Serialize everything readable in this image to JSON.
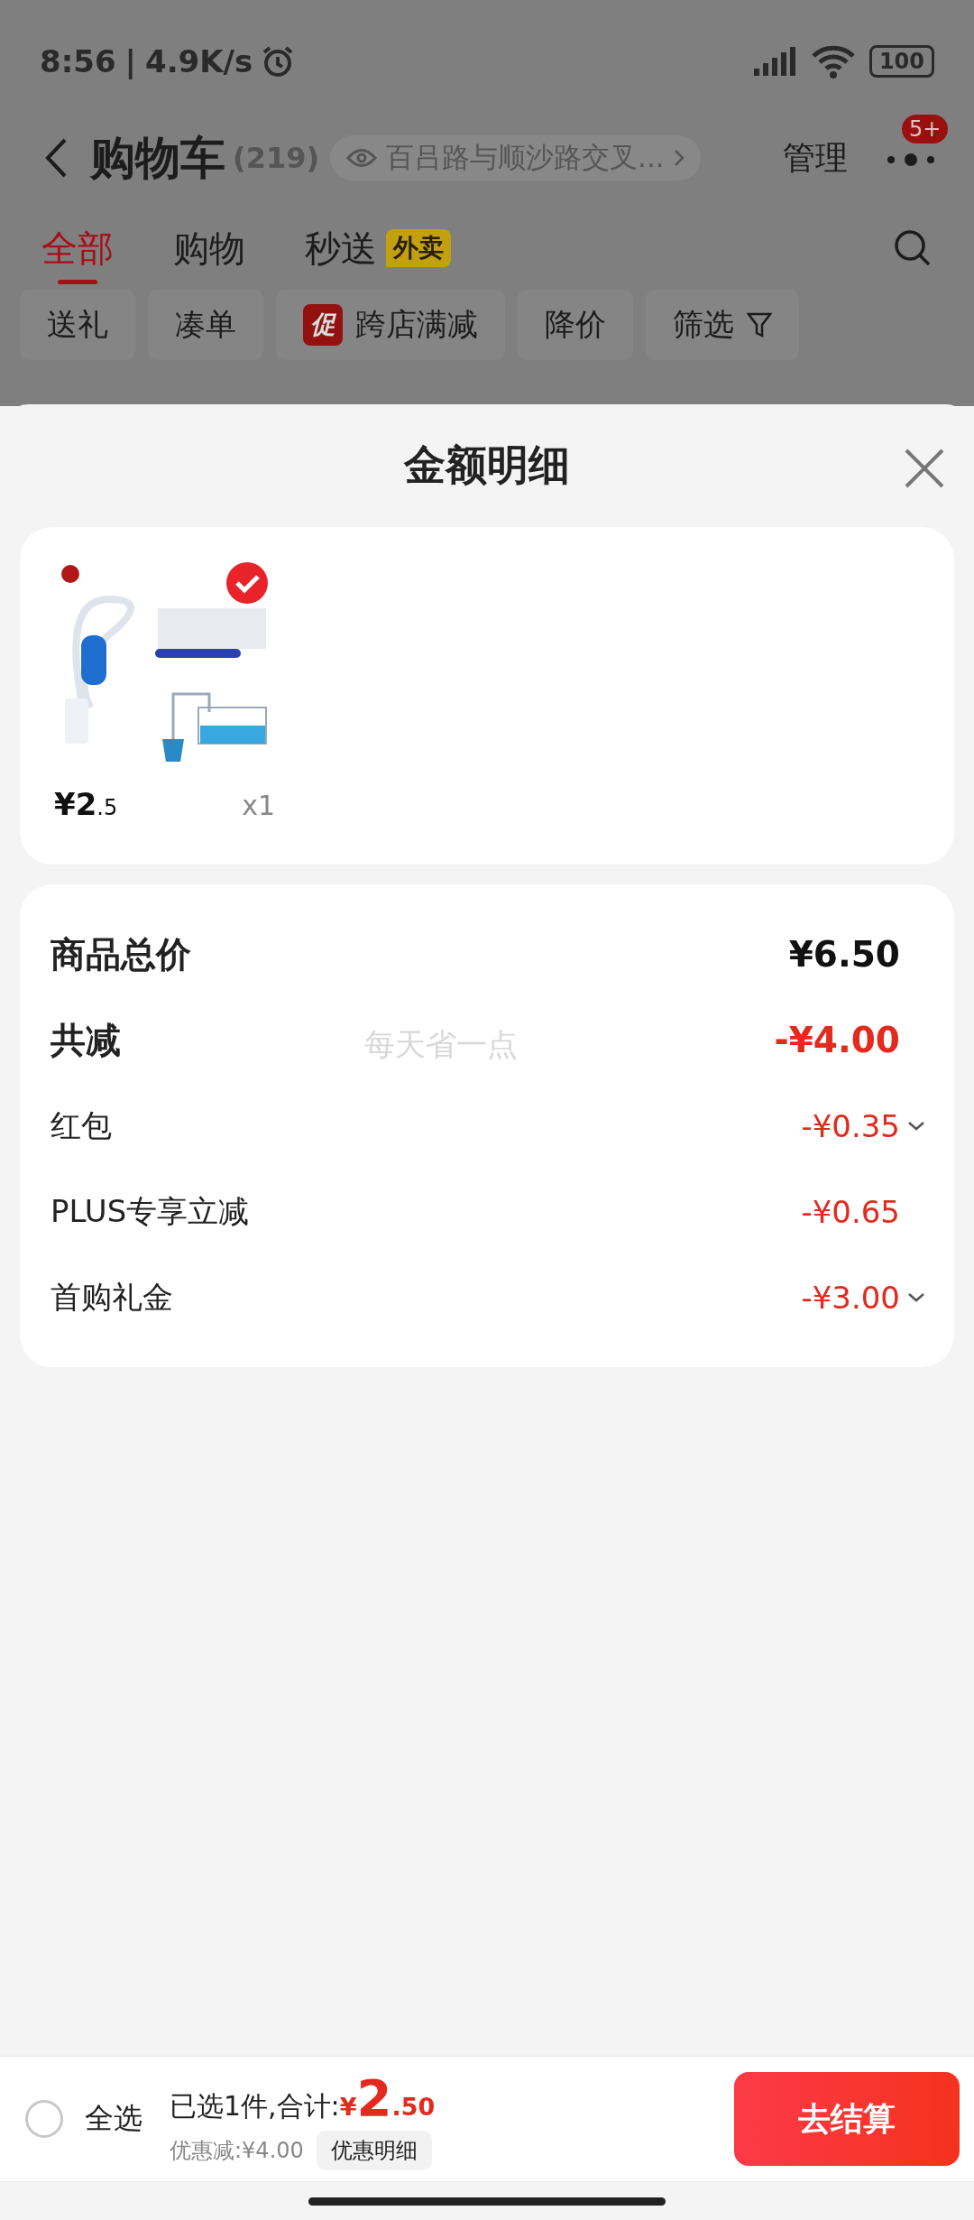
{
  "status_bar": {
    "time": "8:56",
    "separator": "|",
    "speed": "4.9K/s",
    "battery": "100"
  },
  "header": {
    "title": "购物车",
    "count": "(219)",
    "address": "百吕路与顺沙路交叉...",
    "manage": "管理",
    "badge": "5+"
  },
  "tabs": [
    {
      "label": "全部",
      "selected": true
    },
    {
      "label": "购物",
      "selected": false
    },
    {
      "label": "秒送",
      "selected": false,
      "tag": "外卖"
    }
  ],
  "filters": [
    {
      "label": "送礼"
    },
    {
      "label": "凑单"
    },
    {
      "label": "跨店满减",
      "promo": "促"
    },
    {
      "label": "降价"
    },
    {
      "label": "筛选",
      "dropdown": true
    }
  ],
  "sheet": {
    "title": "金额明细",
    "watermark": "每天省一点",
    "items": [
      {
        "kind": "picture",
        "selected": true,
        "price_main": "¥2",
        "price_decimal": ".5",
        "quantity": "x1"
      }
    ],
    "rows": [
      {
        "kind": "total",
        "label": "商品总价",
        "value": "¥6.50",
        "expandable": false
      },
      {
        "kind": "saving",
        "label": "共减",
        "value": "-¥4.00",
        "expandable": false
      },
      {
        "kind": "item",
        "label": "红包",
        "value": "-¥0.35",
        "expandable": true
      },
      {
        "kind": "item",
        "label": "PLUS专享立减",
        "value": "-¥0.65",
        "expandable": false
      },
      {
        "kind": "item",
        "label": "首购礼金",
        "value": "-¥3.00",
        "expandable": true
      }
    ]
  },
  "bottom_bar": {
    "select_all": {
      "label": "全选",
      "checked": false
    },
    "summary": "已选1件,合计:",
    "total_currency": "¥",
    "total_integer": "2",
    "total_decimal": ".50",
    "discount": "优惠减:¥4.00",
    "details_button": "优惠明细",
    "checkout": "去结算"
  }
}
